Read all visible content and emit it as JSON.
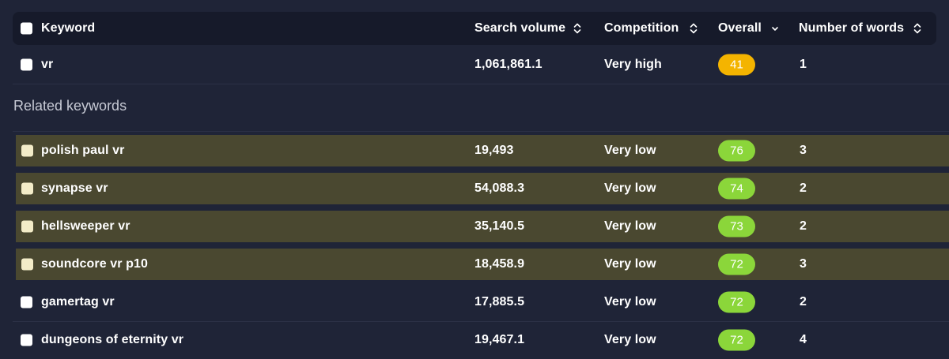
{
  "header": {
    "keyword": "Keyword",
    "search_volume": "Search volume",
    "competition": "Competition",
    "overall": "Overall",
    "number_of_words": "Number of words"
  },
  "main_row": {
    "keyword": "vr",
    "search_volume": "1,061,861.1",
    "competition": "Very high",
    "overall": "41",
    "number_of_words": "1",
    "badge_color": "#f4b400"
  },
  "related_label": "Related keywords",
  "related": [
    {
      "keyword": "polish paul vr",
      "search_volume": "19,493",
      "competition": "Very low",
      "overall": "76",
      "number_of_words": "3",
      "highlighted": true
    },
    {
      "keyword": "synapse vr",
      "search_volume": "54,088.3",
      "competition": "Very low",
      "overall": "74",
      "number_of_words": "2",
      "highlighted": true
    },
    {
      "keyword": "hellsweeper vr",
      "search_volume": "35,140.5",
      "competition": "Very low",
      "overall": "73",
      "number_of_words": "2",
      "highlighted": true
    },
    {
      "keyword": "soundcore vr p10",
      "search_volume": "18,458.9",
      "competition": "Very low",
      "overall": "72",
      "number_of_words": "3",
      "highlighted": true
    },
    {
      "keyword": "gamertag vr",
      "search_volume": "17,885.5",
      "competition": "Very low",
      "overall": "72",
      "number_of_words": "2",
      "highlighted": false
    },
    {
      "keyword": "dungeons of eternity vr",
      "search_volume": "19,467.1",
      "competition": "Very low",
      "overall": "72",
      "number_of_words": "4",
      "highlighted": false
    }
  ],
  "colors": {
    "background": "#1f2437",
    "header_bg": "#161a2a",
    "highlight_bg": "#4a4830",
    "badge_green": "#8bd63a",
    "badge_yellow": "#f4b400"
  },
  "icons": {
    "sort": "sort-updown-icon",
    "sort_active": "chevron-down-icon"
  }
}
